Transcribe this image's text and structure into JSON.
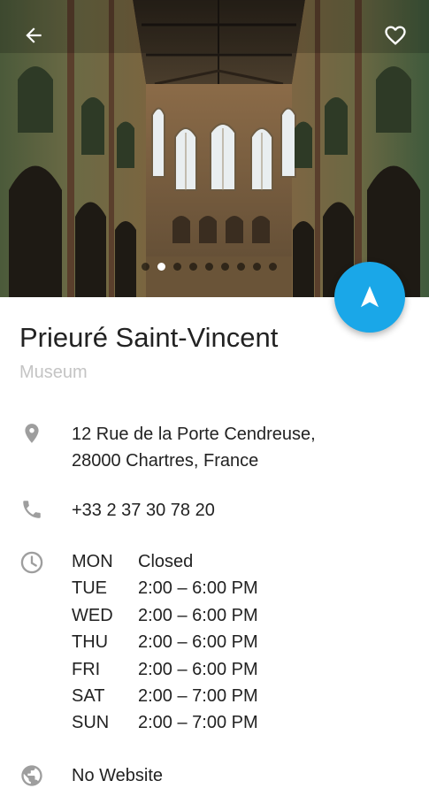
{
  "place": {
    "name": "Prieuré Saint-Vincent",
    "category": "Museum"
  },
  "gallery": {
    "photo_count": 9,
    "active_index": 1
  },
  "address": {
    "line1": "12 Rue de la Porte Cendreuse,",
    "line2": "28000 Chartres, France"
  },
  "phone": "+33 2 37 30 78 20",
  "hours": [
    {
      "day": "MON",
      "time": "Closed"
    },
    {
      "day": "TUE",
      "time": "2:00 – 6:00 PM"
    },
    {
      "day": "WED",
      "time": "2:00 – 6:00 PM"
    },
    {
      "day": "THU",
      "time": "2:00 – 6:00 PM"
    },
    {
      "day": "FRI",
      "time": "2:00 – 6:00 PM"
    },
    {
      "day": "SAT",
      "time": "2:00 – 7:00 PM"
    },
    {
      "day": "SUN",
      "time": "2:00 – 7:00 PM"
    }
  ],
  "website": "No Website",
  "icons": {
    "back": "arrow-back-icon",
    "favorite": "heart-outline-icon",
    "navigate": "navigation-arrow-icon",
    "address": "location-pin-icon",
    "phone": "phone-icon",
    "hours": "clock-icon",
    "website": "globe-icon"
  },
  "colors": {
    "accent": "#1aa7e8",
    "icon_gray": "#9e9e9e",
    "subtitle_gray": "#c4c4c4"
  }
}
